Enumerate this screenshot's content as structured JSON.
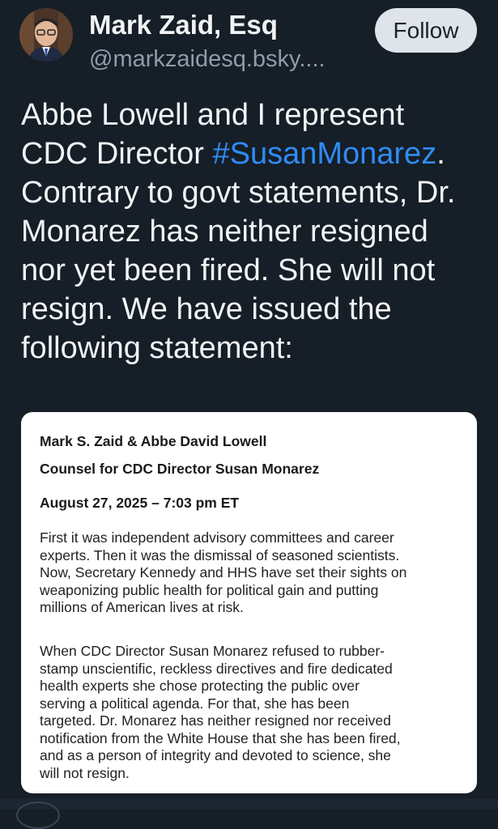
{
  "author": {
    "display_name": "Mark Zaid, Esq",
    "handle": "@markzaidesq.bsky...."
  },
  "follow_button": {
    "label": "Follow"
  },
  "post": {
    "lines": [
      [
        "Abbe Lowell and I represent"
      ],
      [
        "CDC Director ",
        "#SusanMonarez",
        "."
      ],
      [
        "Contrary to govt statements, Dr."
      ],
      [
        "Monarez has neither resigned"
      ],
      [
        "nor yet been fired. She will not"
      ],
      [
        "resign. We have issued the"
      ],
      [
        "following statement:"
      ]
    ],
    "hashtag": "#SusanMonarez"
  },
  "statement": {
    "authors": "Mark S. Zaid & Abbe David Lowell",
    "role": "Counsel for CDC Director Susan Monarez",
    "date": "August 27, 2025 – 7:03 pm ET",
    "paragraph1": [
      "First it was independent advisory committees and career",
      "experts. Then it was the dismissal of seasoned scientists.",
      "Now, Secretary Kennedy and HHS have set their sights on",
      "weaponizing public health for political gain and putting",
      "millions of American lives at risk."
    ],
    "paragraph2": [
      "When CDC Director Susan Monarez refused to rubber-",
      "stamp unscientific, reckless directives and fire dedicated",
      "health experts she chose protecting the public over",
      "serving a political agenda. For that, she has been",
      "targeted. Dr. Monarez has neither resigned nor received",
      "notification from the White House that she has been fired,",
      "and as a person of integrity and devoted to science, she",
      "will not resign."
    ]
  },
  "colors": {
    "background": "#161e27",
    "text": "#f1f3f5",
    "handle": "#8f9cab",
    "hashtag": "#2f8cf5",
    "follow_bg": "#dfe4ea"
  }
}
